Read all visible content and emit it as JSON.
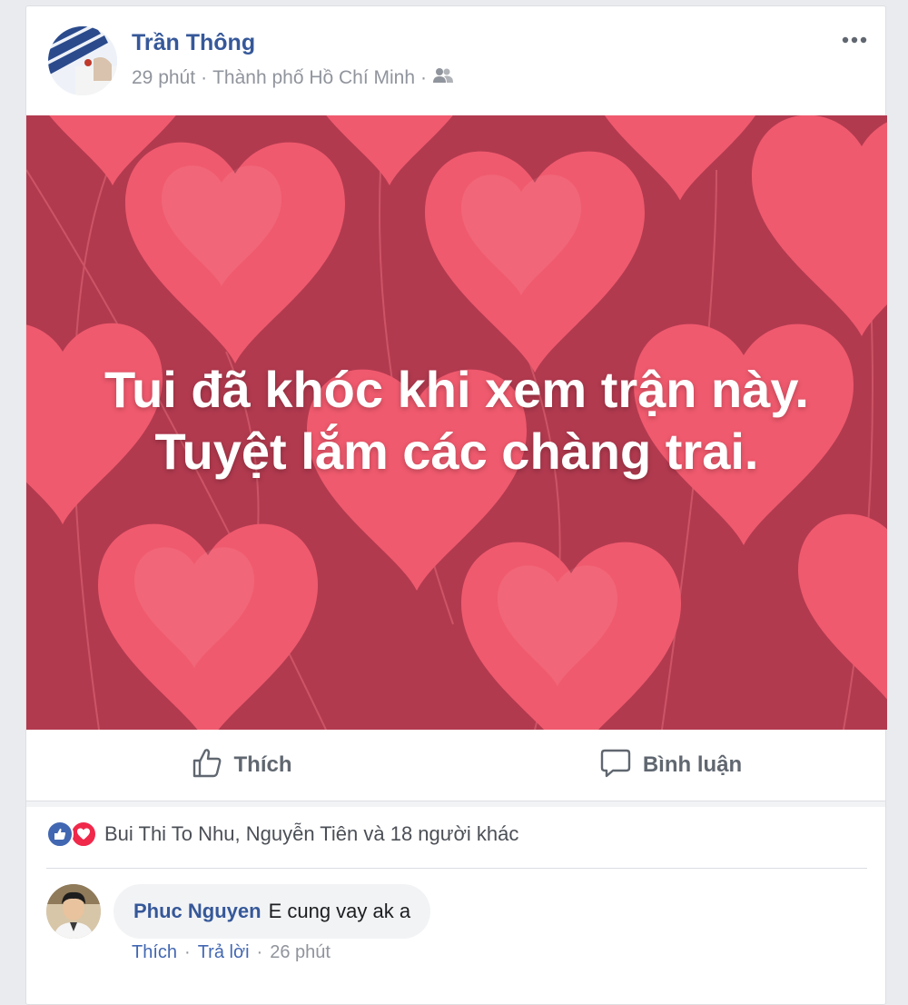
{
  "post": {
    "author": "Trần Thông",
    "time": "29 phút",
    "location": "Thành phố Hồ Chí Minh",
    "dot": "·",
    "audience_icon": "friends-icon",
    "more_icon": "more-options-icon",
    "text_line1": "Tui đã khóc khi xem trận này.",
    "text_line2": "Tuyệt lắm các chàng trai.",
    "background_color": "#b23a4f",
    "heart_color": "#f05a6e"
  },
  "actions": {
    "like_label": "Thích",
    "comment_label": "Bình luận"
  },
  "reactions": {
    "summary": "Bui Thi To Nhu, Nguyễn Tiên và 18 người khác",
    "icons": [
      "like-reaction-icon",
      "love-reaction-icon"
    ]
  },
  "comment": {
    "name": "Phuc Nguyen",
    "text": "E cung vay ak a",
    "like_label": "Thích",
    "reply_label": "Trả lời",
    "time": "26 phút",
    "dot": "·"
  },
  "colors": {
    "link": "#365899",
    "muted": "#90949c",
    "like_blue": "#4267b2",
    "love_red": "#f0284a"
  }
}
